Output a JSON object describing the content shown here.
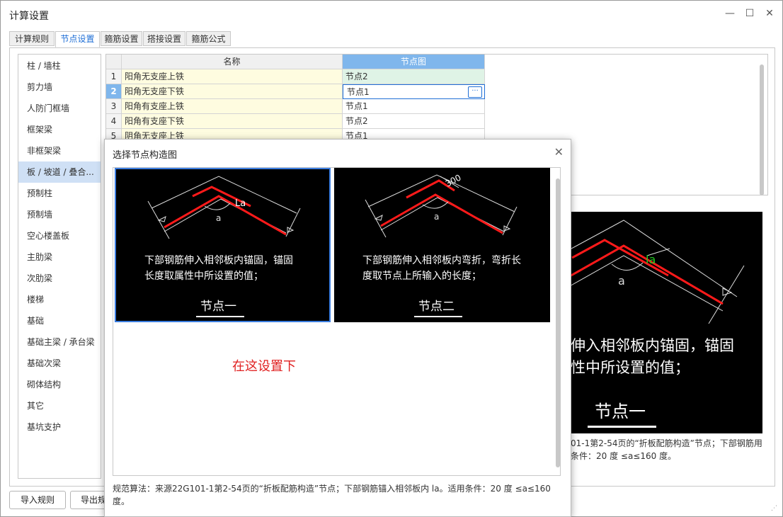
{
  "window": {
    "title": "计算设置"
  },
  "tabs": [
    "计算规则",
    "节点设置",
    "箍筋设置",
    "搭接设置",
    "箍筋公式"
  ],
  "sidebar": {
    "items": [
      "柱 / 墙柱",
      "剪力墙",
      "人防门框墙",
      "框架梁",
      "非框架梁",
      "板 / 坡道 / 叠合...",
      "预制柱",
      "预制墙",
      "空心楼盖板",
      "主肋梁",
      "次肋梁",
      "楼梯",
      "基础",
      "基础主梁 / 承台梁",
      "基础次梁",
      "砌体结构",
      "其它",
      "基坑支护"
    ],
    "selected_index": 5
  },
  "grid": {
    "headers": {
      "name": "名称",
      "node": "节点图"
    },
    "rows": [
      {
        "num": "1",
        "name": "阳角无支座上铁",
        "node": "节点2"
      },
      {
        "num": "2",
        "name": "阳角无支座下铁",
        "node": "节点1"
      },
      {
        "num": "3",
        "name": "阳角有支座上铁",
        "node": "节点1"
      },
      {
        "num": "4",
        "name": "阳角有支座下铁",
        "node": "节点2"
      },
      {
        "num": "5",
        "name": "阴角无支座上铁",
        "node": "节点1"
      }
    ],
    "ellipsis": "···"
  },
  "preview": {
    "la_label": "la",
    "angle_label": "a",
    "text_line1": "伸入相邻板内锚固，锚固",
    "text_line2": "性中所设置的值；",
    "caption": "节点一",
    "desc": "01-1第2-54页的“折板配筋构造”节点；下部钢筋用条件：20 度 ≤a≤160 度。"
  },
  "buttons": {
    "import": "导入规则",
    "export": "导出规"
  },
  "dialog": {
    "title": "选择节点构造图",
    "close": "✕",
    "note": "在这设置下",
    "desc": "规范算法：来源22G101-1第2-54页的“折板配筋构造”节点；下部钢筋锚入相邻板内 la。适用条件：20 度 ≤a≤160 度。",
    "options": [
      {
        "line1": "下部钢筋伸入相邻板内锚固，锚固",
        "line2": "长度取属性中所设置的值；",
        "caption": "节点一",
        "la": "La",
        "angle": "a"
      },
      {
        "line1": "下部钢筋伸入相邻板内弯折，弯折长",
        "line2": "度取节点上所输入的长度；",
        "caption": "节点二",
        "dim": "300",
        "angle": "a"
      }
    ]
  },
  "colors": {
    "accent": "#1f6fd6",
    "selected_header": "#7fb6ec",
    "rebar": "#ff1a1a",
    "note": "#e02020"
  }
}
